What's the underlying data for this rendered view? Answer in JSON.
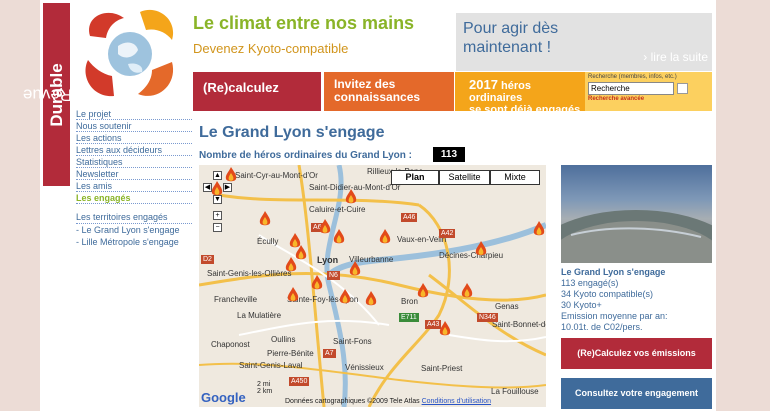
{
  "logo": {
    "word1": "LaRevue",
    "word2": "Durable"
  },
  "header": {
    "title": "Le climat entre nos mains",
    "subtitle": "Devenez Kyoto-compatible"
  },
  "promo": {
    "text": "Pour agir dès maintenant !",
    "link": "lire la suite"
  },
  "nav": {
    "calculate": "(Re)calculez",
    "invite": "Invitez des connaissances",
    "heroes_count": "2017",
    "heroes_text": "héros ordinaires",
    "heroes_text2": "se sont déjà engagés"
  },
  "search": {
    "label": "Recherche (membres, infos, etc.)",
    "value": "Recherche",
    "advanced": "Recherche avancée"
  },
  "sidebar": {
    "items": [
      {
        "label": "Le projet"
      },
      {
        "label": "Nous soutenir"
      },
      {
        "label": "Les actions"
      },
      {
        "label": "Lettres aux décideurs"
      },
      {
        "label": "Statistiques"
      },
      {
        "label": "Newsletter"
      },
      {
        "label": "Les amis"
      },
      {
        "label": "Les engagés"
      }
    ],
    "territories_title": "Les territoires engagés",
    "territories": [
      {
        "label": "- Le Grand Lyon s'engage"
      },
      {
        "label": "- Lille Métropole s'engage"
      }
    ]
  },
  "main": {
    "title": "Le Grand Lyon s'engage",
    "hero_label": "Nombre de héros ordinaires du Grand Lyon :",
    "hero_count": "113"
  },
  "map": {
    "types": [
      "Plan",
      "Satellite",
      "Mixte"
    ],
    "places": [
      "Saint-Cyr-au-Mont-d'Or",
      "Saint-Didier-au-Mont-d'Or",
      "Rillieux-la-Pape",
      "Caluire-et-Cuire",
      "Écully",
      "Vaux-en-Velin",
      "Villeurbanne",
      "Saint-Genis-les-Ollières",
      "Lyon",
      "Décines-Charpieu",
      "Francheville",
      "Sainte-Foy-lès-Lyon",
      "Bron",
      "Genas",
      "Saint-Bonnet-de-Mure",
      "La Mulatière",
      "Oullins",
      "Chaponost",
      "Pierre-Bénite",
      "Saint-Fons",
      "Vénissieux",
      "Saint-Priest",
      "Saint-Genis-Laval",
      "La Fouillouse"
    ],
    "roads": [
      "A46",
      "A6",
      "N6",
      "A42",
      "A43",
      "E711",
      "N346",
      "A7",
      "A450",
      "D2"
    ],
    "scale_mi": "2 mi",
    "scale_km": "2 km",
    "copyright": "Données cartographiques ©2009 Tele Atlas",
    "terms": "Conditions d'utilisation",
    "google": "Google"
  },
  "profile": {
    "title": "Le Grand Lyon s'engage",
    "engaged": "113 engagé(s)",
    "kyoto": "34 Kyoto compatible(s)",
    "kyoto_plus": "30 Kyoto+",
    "emission_label": "Emission moyenne par an:",
    "emission_value": "10.01t. de C02/pers."
  },
  "buttons": {
    "recalc": "(Re)Calculez vos émissions",
    "consult": "Consultez votre engagement"
  },
  "colors": {
    "brand_red": "#b22b3a",
    "accent_green": "#8ab428",
    "link_blue": "#3f6b9b",
    "orange": "#e4692a",
    "amber": "#f4a51a"
  }
}
